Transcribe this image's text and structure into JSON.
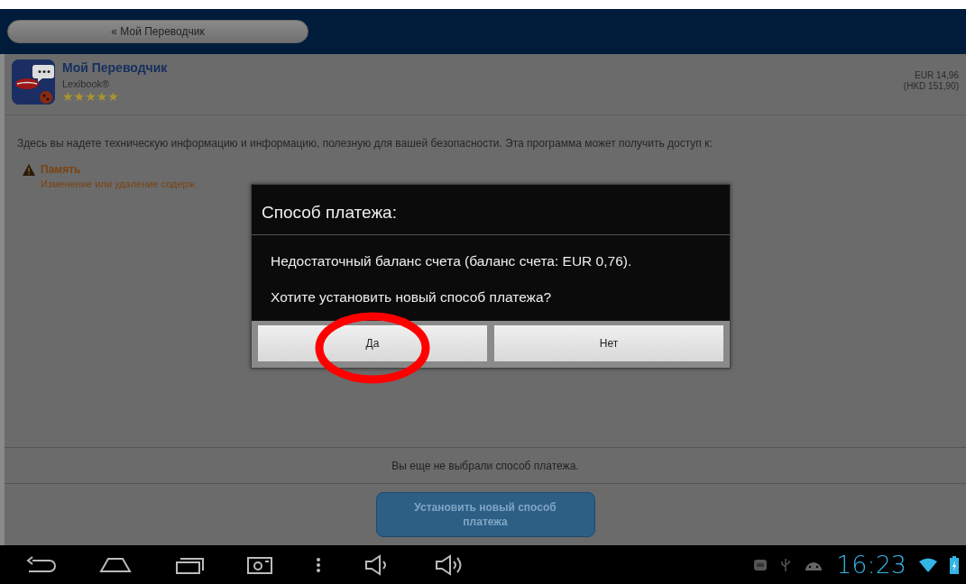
{
  "top_bar": {
    "back_button": "« Мой Переводчик"
  },
  "app": {
    "title": "Мой Переводчик",
    "developer": "Lexibook®",
    "stars": 5,
    "price": "EUR 14,96",
    "price_alt": "(HKD 151,90)"
  },
  "description": "Здесь вы надете техническую информацию и информацию, полезную для вашей безопасности. Эта программа может получить доступ к:",
  "permissions": [
    {
      "title": "Память",
      "detail": "Изменение или удаление содерж"
    }
  ],
  "dialog": {
    "title": "Способ платежа:",
    "messages": [
      "Недостаточный баланс счета (баланс счета: EUR 0,76).",
      "Хотите установить новый способ платежа?"
    ],
    "buttons": [
      {
        "label": "Да",
        "highlighted": true
      },
      {
        "label": "Нет",
        "highlighted": false
      }
    ]
  },
  "payment_status": "Вы еще не выбрали способ платежа.",
  "set_payment_button": "Установить новый способ платежа",
  "status_bar": {
    "time": "16:23"
  }
}
